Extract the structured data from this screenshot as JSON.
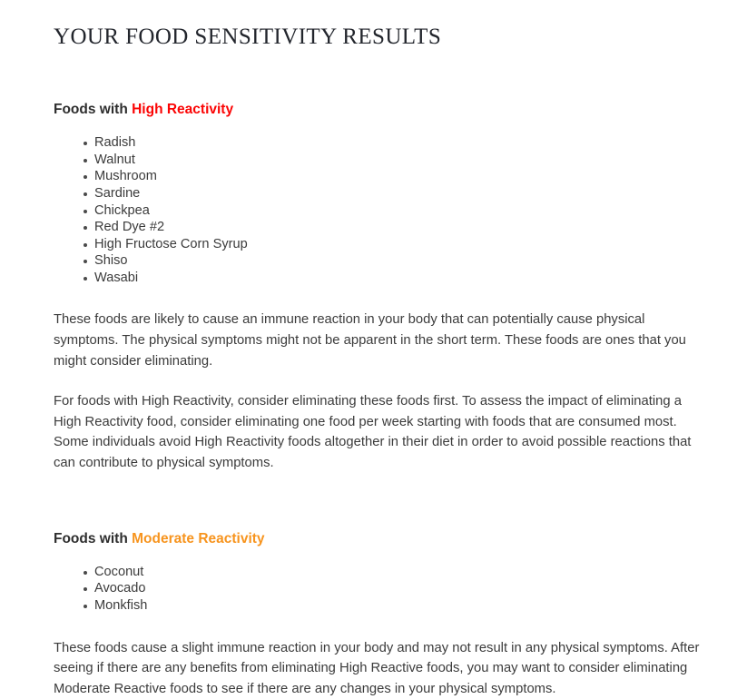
{
  "document": {
    "title": "YOUR FOOD SENSITIVITY RESULTS"
  },
  "colors": {
    "high_reactivity": "#fb0404",
    "moderate_reactivity": "#f7941e",
    "body_text": "#3b3b3b",
    "heading_text": "#2e2e2e",
    "title_text": "#23262d",
    "background": "#ffffff"
  },
  "sections": {
    "high": {
      "heading_prefix": "Foods with ",
      "heading_accent": "High Reactivity",
      "foods": [
        "Radish",
        "Walnut",
        "Mushroom",
        "Sardine",
        "Chickpea",
        "Red Dye #2",
        "High Fructose Corn Syrup",
        "Shiso",
        "Wasabi"
      ],
      "paragraph_1": "These foods are likely to cause an immune reaction in your body that can potentially cause physical symptoms. The physical symptoms might not be apparent in the short term. These foods are ones that you might consider eliminating.",
      "paragraph_2": "For foods with High Reactivity, consider eliminating these foods first. To assess the impact of eliminating a High Reactivity food, consider eliminating one food per week starting with foods that are consumed most. Some individuals avoid High Reactivity foods altogether in their diet in order to avoid possible reactions that can contribute to physical symptoms."
    },
    "moderate": {
      "heading_prefix": "Foods with ",
      "heading_accent": "Moderate Reactivity",
      "foods": [
        "Coconut",
        "Avocado",
        "Monkfish"
      ],
      "paragraph_1": "These foods cause a slight immune reaction in your body and may not result in any physical symptoms. After seeing if there are any benefits from eliminating High Reactive foods, you may want to consider eliminating Moderate Reactive foods to see if there are any changes in your physical symptoms."
    }
  }
}
